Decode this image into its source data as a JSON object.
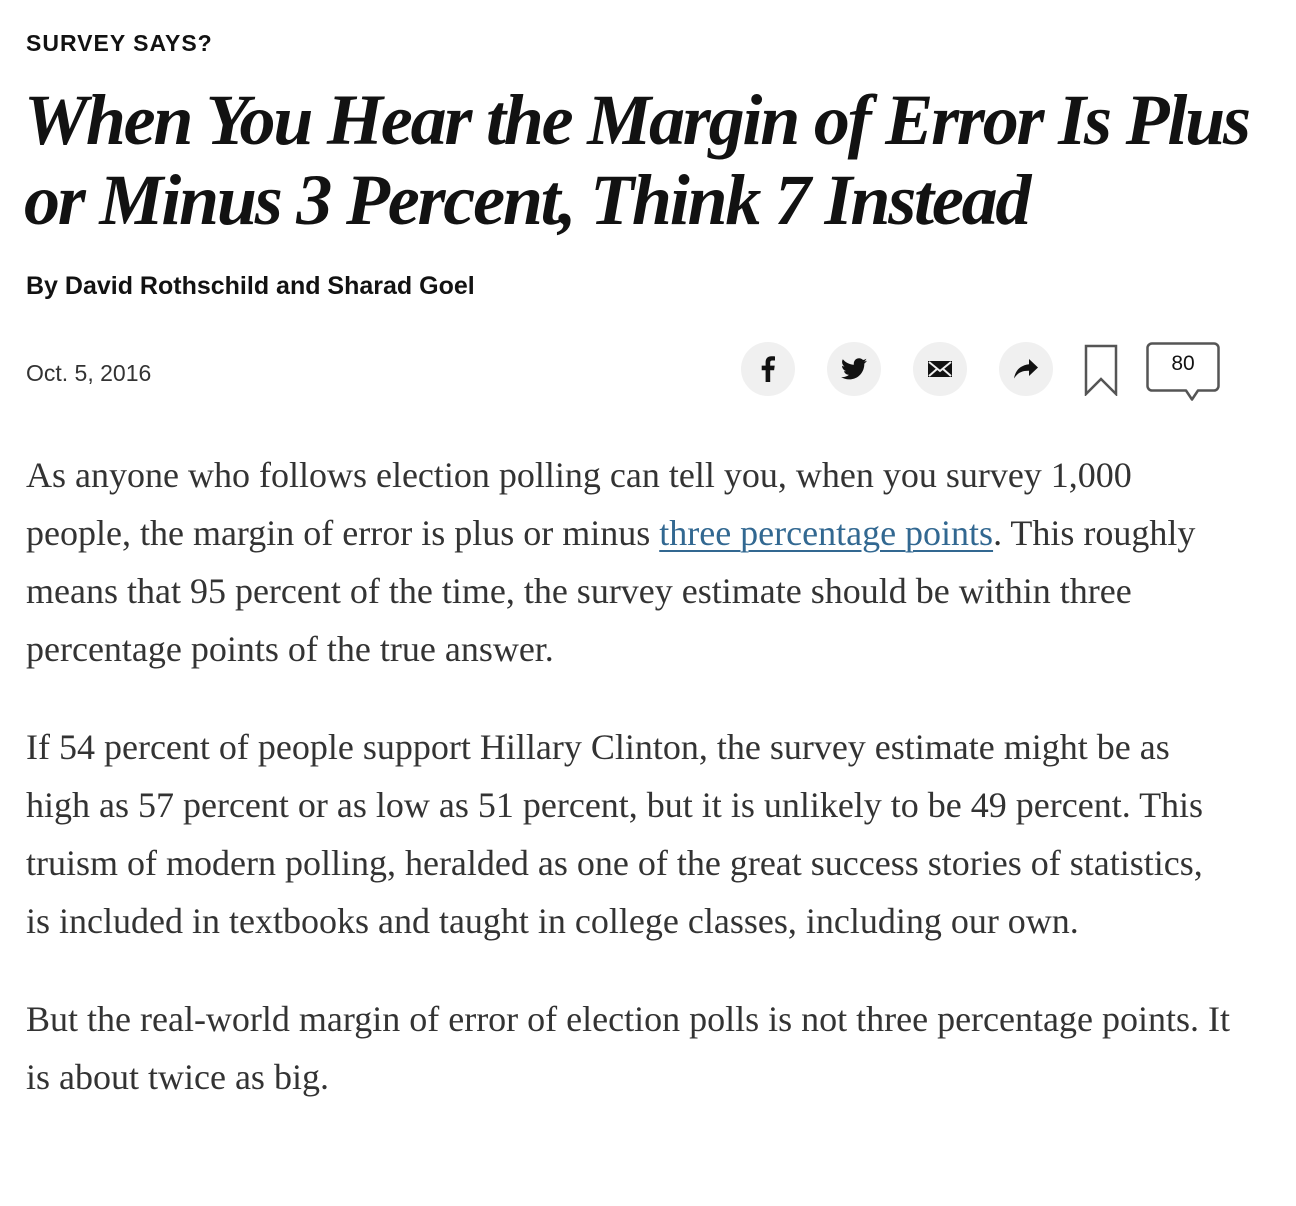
{
  "article": {
    "kicker": "SURVEY SAYS?",
    "headline": "When You Hear the Margin of Error Is Plus or Minus 3 Percent, Think 7 Instead",
    "byline": "By David Rothschild and Sharad Goel",
    "date": "Oct. 5, 2016"
  },
  "toolbar": {
    "facebook_icon": "facebook-icon",
    "twitter_icon": "twitter-icon",
    "email_icon": "email-icon",
    "share_icon": "share-arrow-icon",
    "save_icon": "bookmark-icon",
    "comment_icon": "speech-bubble-icon",
    "comment_count": "80",
    "button_bg": "#f0f0f0"
  },
  "body": {
    "p1_before_link": "As anyone who follows election polling can tell you, when you survey 1,000 people, the margin of error is plus or minus ",
    "p1_link": "three percentage points",
    "p1_after_link": ". This roughly means that 95 percent of the time, the survey estimate should be within three percentage points of the true answer.",
    "p2": "If 54 percent of people support Hillary Clinton, the survey estimate might be as high as 57 percent or as low as 51 percent, but it is unlikely to be 49 percent. This truism of modern polling, heralded as one of the great success stories of statistics, is included in textbooks and taught in college classes, including our own.",
    "p3": "But the real-world margin of error of election polls is not three percentage points. It is about twice as big."
  },
  "colors": {
    "text": "#121212",
    "body_text": "#333333",
    "link": "#326891"
  }
}
